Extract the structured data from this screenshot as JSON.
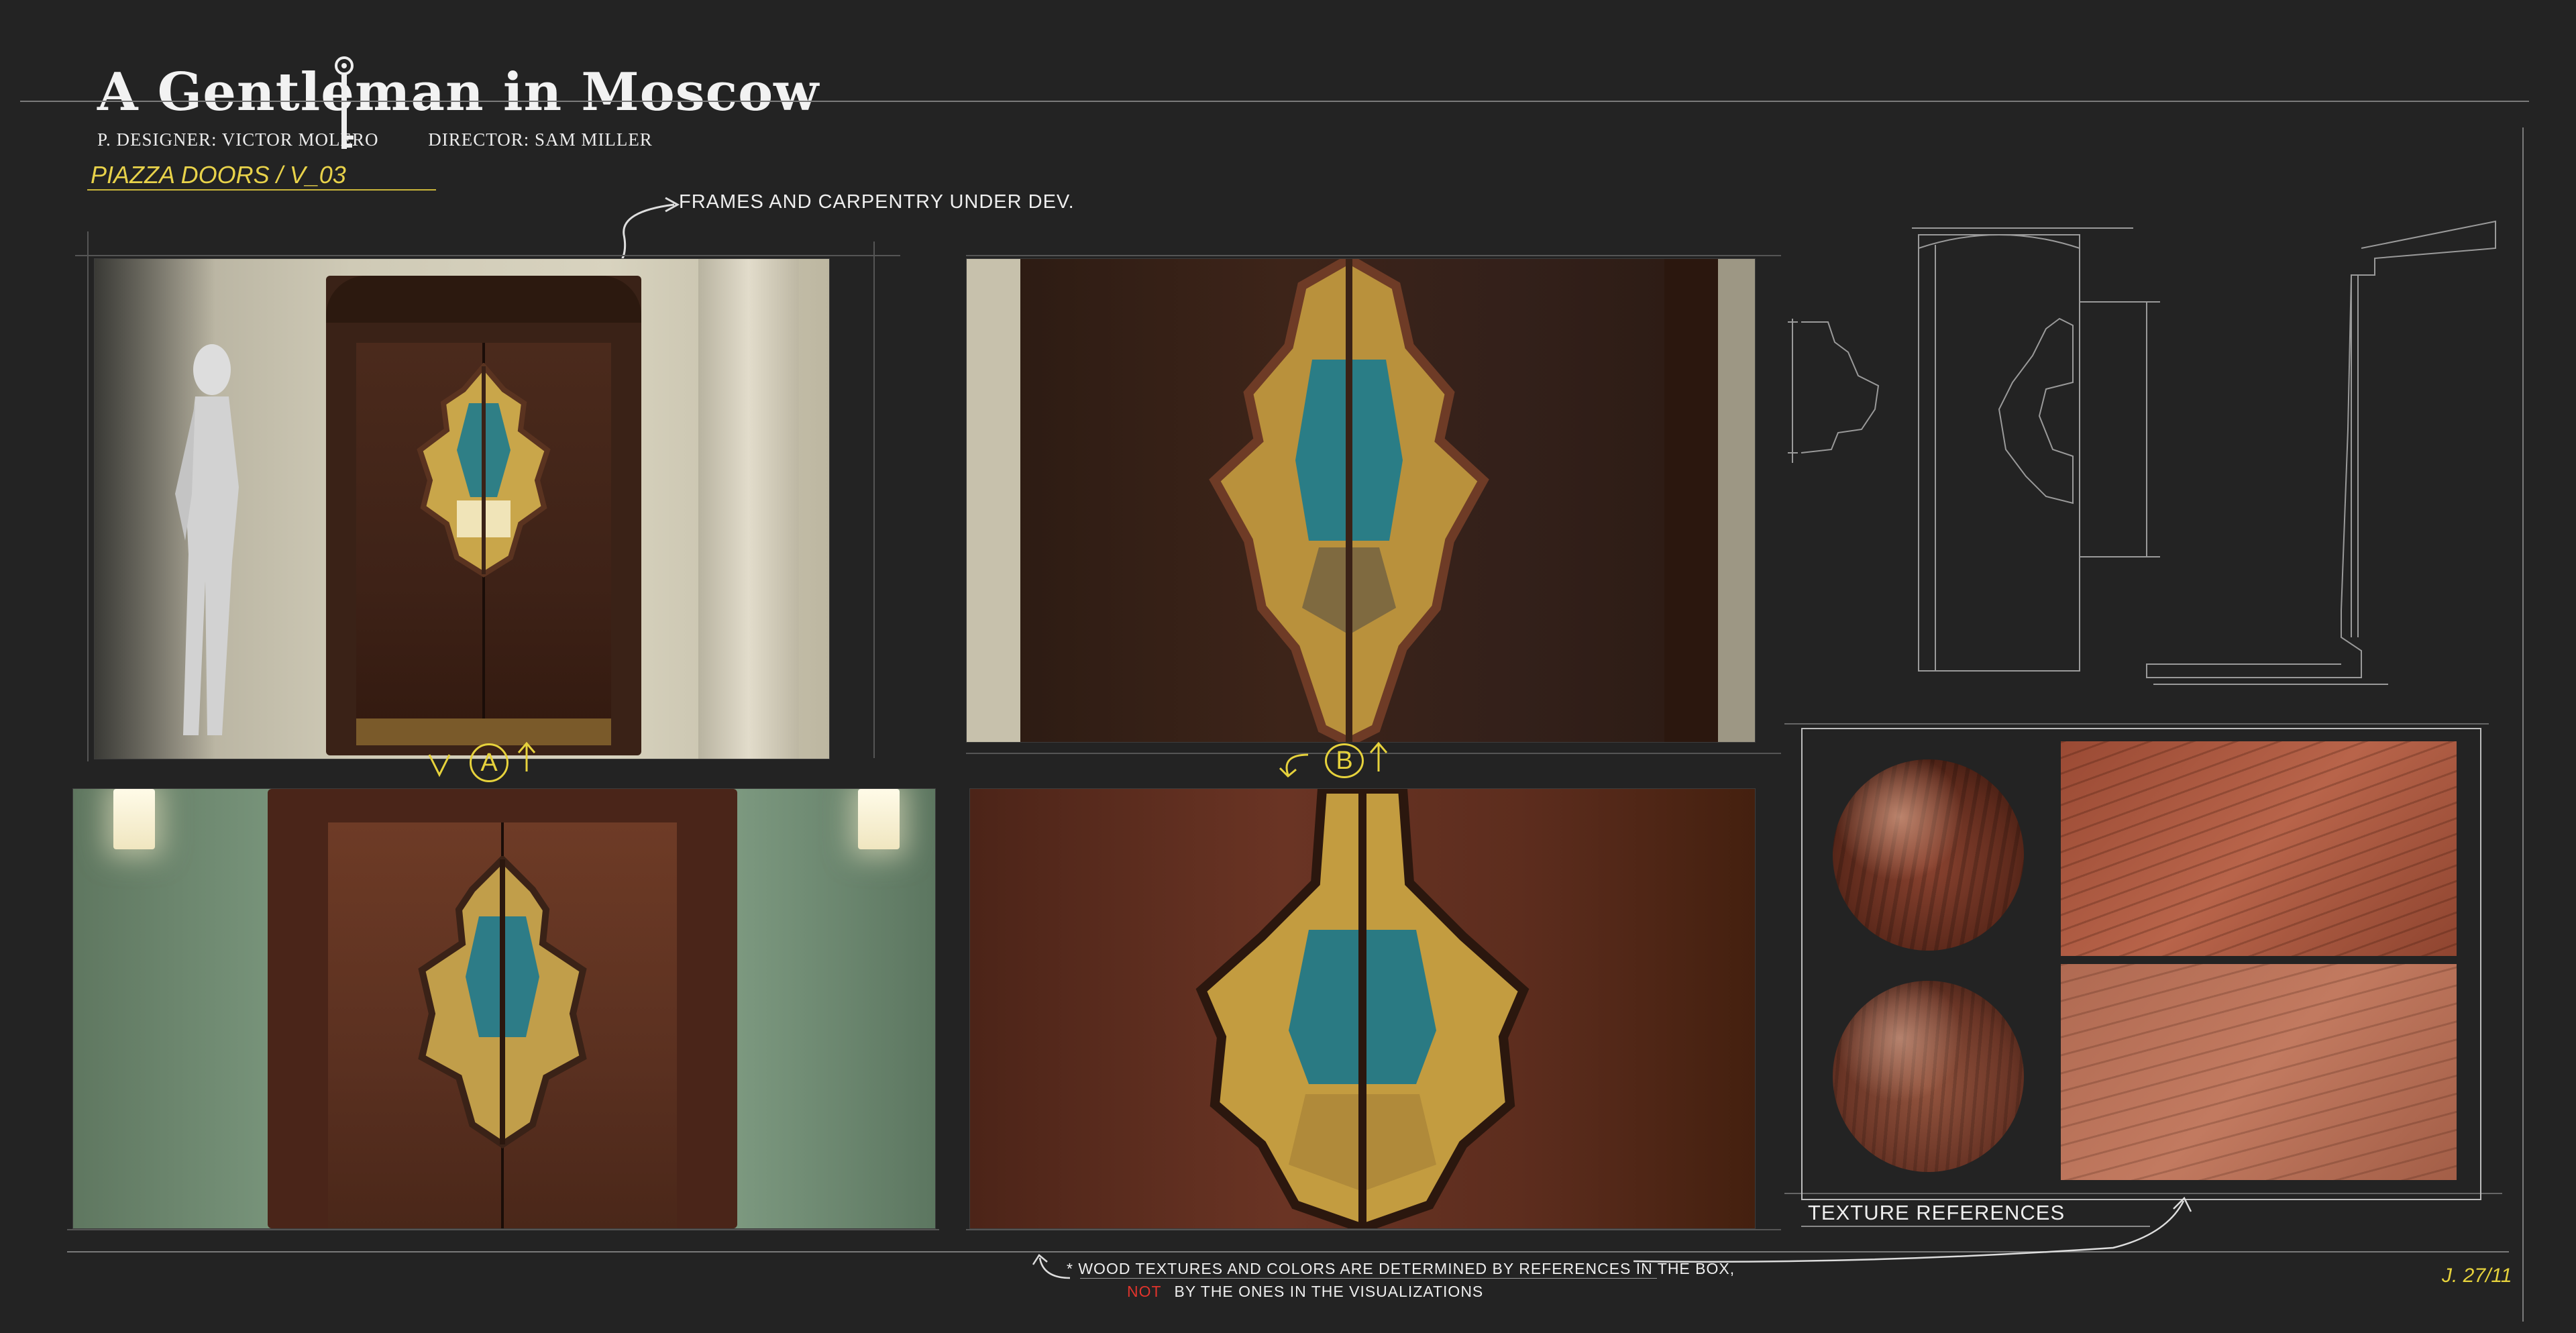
{
  "header": {
    "title": "A Gentleman in Moscow",
    "designer": "P. DESIGNER: VICTOR MOLERO",
    "director": "DIRECTOR: SAM MILLER",
    "subtitle": "PIAZZA DOORS / V_03"
  },
  "notes": {
    "frames_note": "FRAMES AND CARPENTRY UNDER DEV.",
    "option_a": "A",
    "option_b": "B",
    "texture_label": "TEXTURE REFERENCES",
    "footnote_line1": "* WOOD TEXTURES AND COLORS ARE DETERMINED BY REFERENCES IN THE BOX,",
    "footnote_not": "NOT",
    "footnote_line2_rest": "BY THE ONES IN THE VISUALIZATIONS",
    "signature": "J. 27/11"
  },
  "colors": {
    "background": "#232323",
    "accent_yellow": "#e6d23c",
    "warning_red": "#e0342c",
    "line_gray": "#7a7a7a"
  },
  "icons": [
    "key-icon",
    "arrow-icon"
  ]
}
